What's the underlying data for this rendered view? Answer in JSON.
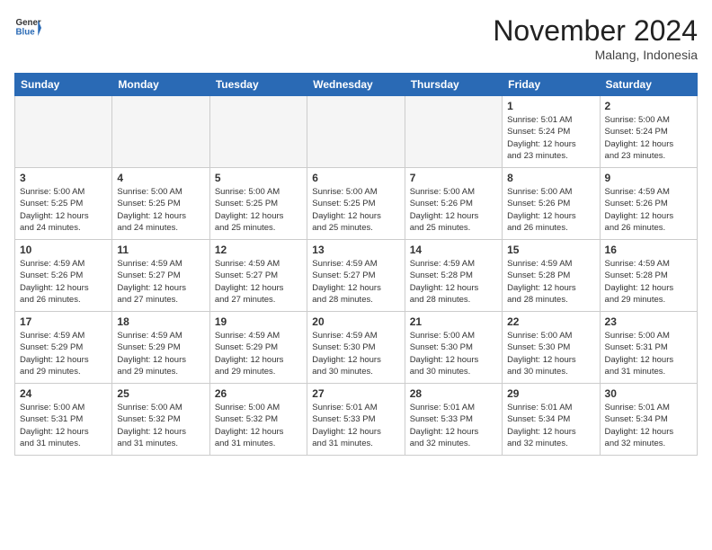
{
  "header": {
    "logo_general": "General",
    "logo_blue": "Blue",
    "month_title": "November 2024",
    "location": "Malang, Indonesia"
  },
  "days_of_week": [
    "Sunday",
    "Monday",
    "Tuesday",
    "Wednesday",
    "Thursday",
    "Friday",
    "Saturday"
  ],
  "weeks": [
    [
      {
        "day": "",
        "info": ""
      },
      {
        "day": "",
        "info": ""
      },
      {
        "day": "",
        "info": ""
      },
      {
        "day": "",
        "info": ""
      },
      {
        "day": "",
        "info": ""
      },
      {
        "day": "1",
        "info": "Sunrise: 5:01 AM\nSunset: 5:24 PM\nDaylight: 12 hours\nand 23 minutes."
      },
      {
        "day": "2",
        "info": "Sunrise: 5:00 AM\nSunset: 5:24 PM\nDaylight: 12 hours\nand 23 minutes."
      }
    ],
    [
      {
        "day": "3",
        "info": "Sunrise: 5:00 AM\nSunset: 5:25 PM\nDaylight: 12 hours\nand 24 minutes."
      },
      {
        "day": "4",
        "info": "Sunrise: 5:00 AM\nSunset: 5:25 PM\nDaylight: 12 hours\nand 24 minutes."
      },
      {
        "day": "5",
        "info": "Sunrise: 5:00 AM\nSunset: 5:25 PM\nDaylight: 12 hours\nand 25 minutes."
      },
      {
        "day": "6",
        "info": "Sunrise: 5:00 AM\nSunset: 5:25 PM\nDaylight: 12 hours\nand 25 minutes."
      },
      {
        "day": "7",
        "info": "Sunrise: 5:00 AM\nSunset: 5:26 PM\nDaylight: 12 hours\nand 25 minutes."
      },
      {
        "day": "8",
        "info": "Sunrise: 5:00 AM\nSunset: 5:26 PM\nDaylight: 12 hours\nand 26 minutes."
      },
      {
        "day": "9",
        "info": "Sunrise: 4:59 AM\nSunset: 5:26 PM\nDaylight: 12 hours\nand 26 minutes."
      }
    ],
    [
      {
        "day": "10",
        "info": "Sunrise: 4:59 AM\nSunset: 5:26 PM\nDaylight: 12 hours\nand 26 minutes."
      },
      {
        "day": "11",
        "info": "Sunrise: 4:59 AM\nSunset: 5:27 PM\nDaylight: 12 hours\nand 27 minutes."
      },
      {
        "day": "12",
        "info": "Sunrise: 4:59 AM\nSunset: 5:27 PM\nDaylight: 12 hours\nand 27 minutes."
      },
      {
        "day": "13",
        "info": "Sunrise: 4:59 AM\nSunset: 5:27 PM\nDaylight: 12 hours\nand 28 minutes."
      },
      {
        "day": "14",
        "info": "Sunrise: 4:59 AM\nSunset: 5:28 PM\nDaylight: 12 hours\nand 28 minutes."
      },
      {
        "day": "15",
        "info": "Sunrise: 4:59 AM\nSunset: 5:28 PM\nDaylight: 12 hours\nand 28 minutes."
      },
      {
        "day": "16",
        "info": "Sunrise: 4:59 AM\nSunset: 5:28 PM\nDaylight: 12 hours\nand 29 minutes."
      }
    ],
    [
      {
        "day": "17",
        "info": "Sunrise: 4:59 AM\nSunset: 5:29 PM\nDaylight: 12 hours\nand 29 minutes."
      },
      {
        "day": "18",
        "info": "Sunrise: 4:59 AM\nSunset: 5:29 PM\nDaylight: 12 hours\nand 29 minutes."
      },
      {
        "day": "19",
        "info": "Sunrise: 4:59 AM\nSunset: 5:29 PM\nDaylight: 12 hours\nand 29 minutes."
      },
      {
        "day": "20",
        "info": "Sunrise: 4:59 AM\nSunset: 5:30 PM\nDaylight: 12 hours\nand 30 minutes."
      },
      {
        "day": "21",
        "info": "Sunrise: 5:00 AM\nSunset: 5:30 PM\nDaylight: 12 hours\nand 30 minutes."
      },
      {
        "day": "22",
        "info": "Sunrise: 5:00 AM\nSunset: 5:30 PM\nDaylight: 12 hours\nand 30 minutes."
      },
      {
        "day": "23",
        "info": "Sunrise: 5:00 AM\nSunset: 5:31 PM\nDaylight: 12 hours\nand 31 minutes."
      }
    ],
    [
      {
        "day": "24",
        "info": "Sunrise: 5:00 AM\nSunset: 5:31 PM\nDaylight: 12 hours\nand 31 minutes."
      },
      {
        "day": "25",
        "info": "Sunrise: 5:00 AM\nSunset: 5:32 PM\nDaylight: 12 hours\nand 31 minutes."
      },
      {
        "day": "26",
        "info": "Sunrise: 5:00 AM\nSunset: 5:32 PM\nDaylight: 12 hours\nand 31 minutes."
      },
      {
        "day": "27",
        "info": "Sunrise: 5:01 AM\nSunset: 5:33 PM\nDaylight: 12 hours\nand 31 minutes."
      },
      {
        "day": "28",
        "info": "Sunrise: 5:01 AM\nSunset: 5:33 PM\nDaylight: 12 hours\nand 32 minutes."
      },
      {
        "day": "29",
        "info": "Sunrise: 5:01 AM\nSunset: 5:34 PM\nDaylight: 12 hours\nand 32 minutes."
      },
      {
        "day": "30",
        "info": "Sunrise: 5:01 AM\nSunset: 5:34 PM\nDaylight: 12 hours\nand 32 minutes."
      }
    ]
  ]
}
